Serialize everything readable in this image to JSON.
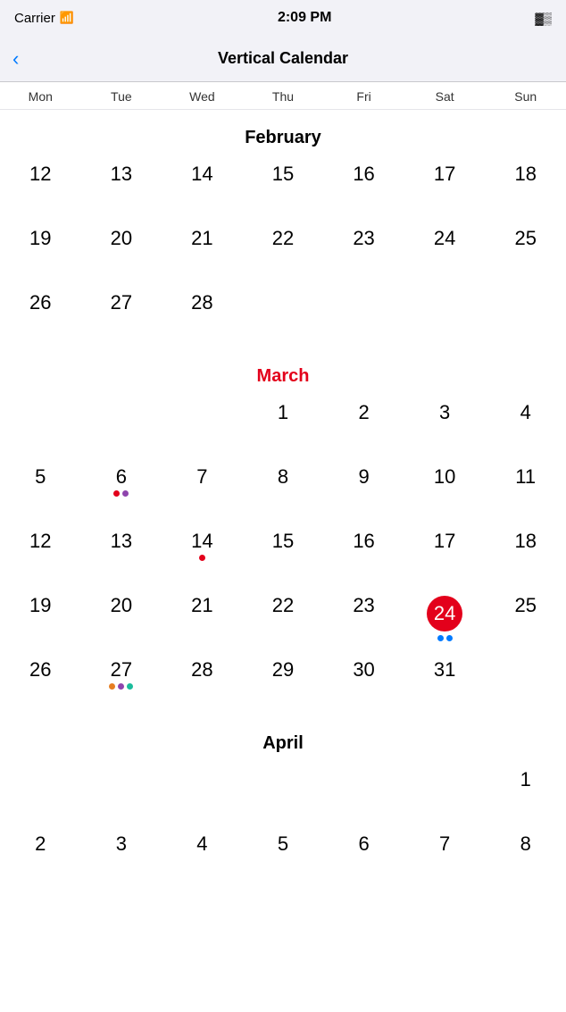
{
  "status": {
    "carrier": "Carrier",
    "time": "2:09 PM",
    "battery": "🔋"
  },
  "nav": {
    "back_label": "‹",
    "title": "Vertical Calendar"
  },
  "day_headers": [
    "Mon",
    "Tue",
    "Wed",
    "Thu",
    "Fri",
    "Sat",
    "Sun"
  ],
  "months": [
    {
      "name": "February",
      "name_class": "regular",
      "partial_top": true,
      "weeks": [
        [
          "12",
          "13",
          "14",
          "15",
          "16",
          "17",
          "18"
        ],
        [
          "19",
          "20",
          "21",
          "22",
          "23",
          "24",
          "25"
        ],
        [
          "26",
          "27",
          "28",
          "",
          "",
          "",
          ""
        ]
      ],
      "dots": {
        "14": [],
        "19": [],
        "26": []
      }
    },
    {
      "name": "March",
      "name_class": "current",
      "partial_top": false,
      "weeks": [
        [
          "",
          "",
          "",
          "1",
          "2",
          "3",
          "4"
        ],
        [
          "5",
          "6",
          "7",
          "8",
          "9",
          "10",
          "11"
        ],
        [
          "12",
          "13",
          "14",
          "15",
          "16",
          "17",
          "18"
        ],
        [
          "19",
          "20",
          "21",
          "22",
          "23",
          "24",
          "25"
        ],
        [
          "26",
          "27",
          "28",
          "29",
          "30",
          "31",
          ""
        ]
      ],
      "today": "24",
      "dots": {
        "6": [
          "red",
          "purple"
        ],
        "14": [
          "red"
        ],
        "24": [
          "blue",
          "blue"
        ],
        "27": [
          "orange",
          "purple",
          "teal"
        ]
      }
    },
    {
      "name": "April",
      "name_class": "regular",
      "partial_top": false,
      "weeks": [
        [
          "",
          "",
          "",
          "",
          "",
          "",
          "1"
        ],
        [
          "2",
          "3",
          "4",
          "5",
          "6",
          "7",
          "8"
        ]
      ],
      "dots": {}
    }
  ]
}
